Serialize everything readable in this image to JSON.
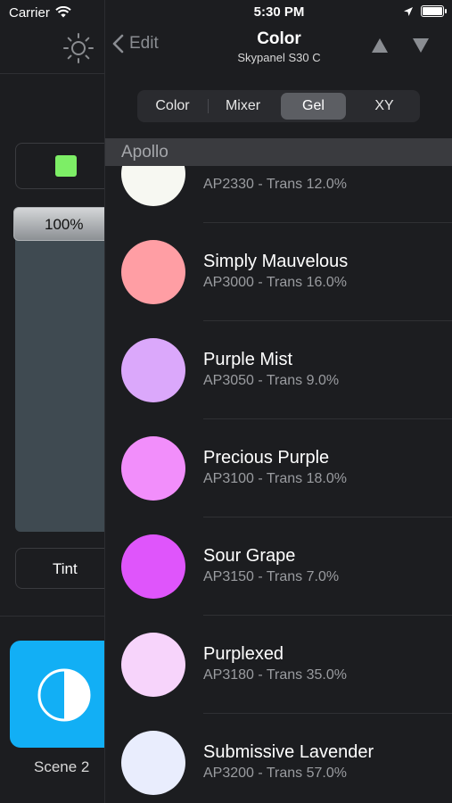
{
  "status": {
    "carrier": "Carrier",
    "time": "5:30 PM"
  },
  "left_panel": {
    "intensity_label": "100%",
    "intensity_value": 1.0,
    "selected_swatch_color": "#7dee66",
    "tint_label": "Tint",
    "scene_label": "Scene 2",
    "scene_color": "#12aff5",
    "icons": [
      "sun-icon",
      "half-circle-icon"
    ]
  },
  "nav": {
    "back_label": "Edit",
    "title": "Color",
    "subtitle": "Skypanel S30 C",
    "icons": [
      "chevron-left-icon",
      "triangle-up-icon",
      "triangle-down-icon"
    ]
  },
  "segments": [
    {
      "label": "Color",
      "selected": false
    },
    {
      "label": "Mixer",
      "selected": false
    },
    {
      "label": "Gel",
      "selected": true
    },
    {
      "label": "XY",
      "selected": false
    }
  ],
  "section": {
    "title": "Apollo"
  },
  "gels": [
    {
      "name": "",
      "code": "AP2330 - Trans 12.0%",
      "color": "#f7f8f2"
    },
    {
      "name": "Simply Mauvelous",
      "code": "AP3000 - Trans 16.0%",
      "color": "#ff9ea4"
    },
    {
      "name": "Purple Mist",
      "code": "AP3050 - Trans 9.0%",
      "color": "#dba8fb"
    },
    {
      "name": "Precious Purple",
      "code": "AP3100 - Trans 18.0%",
      "color": "#f28efb"
    },
    {
      "name": "Sour Grape",
      "code": "AP3150 - Trans 7.0%",
      "color": "#df55fb"
    },
    {
      "name": "Purplexed",
      "code": "AP3180 - Trans 35.0%",
      "color": "#f7d4fb"
    },
    {
      "name": "Submissive Lavender",
      "code": "AP3200 - Trans 57.0%",
      "color": "#e9edfd"
    }
  ]
}
